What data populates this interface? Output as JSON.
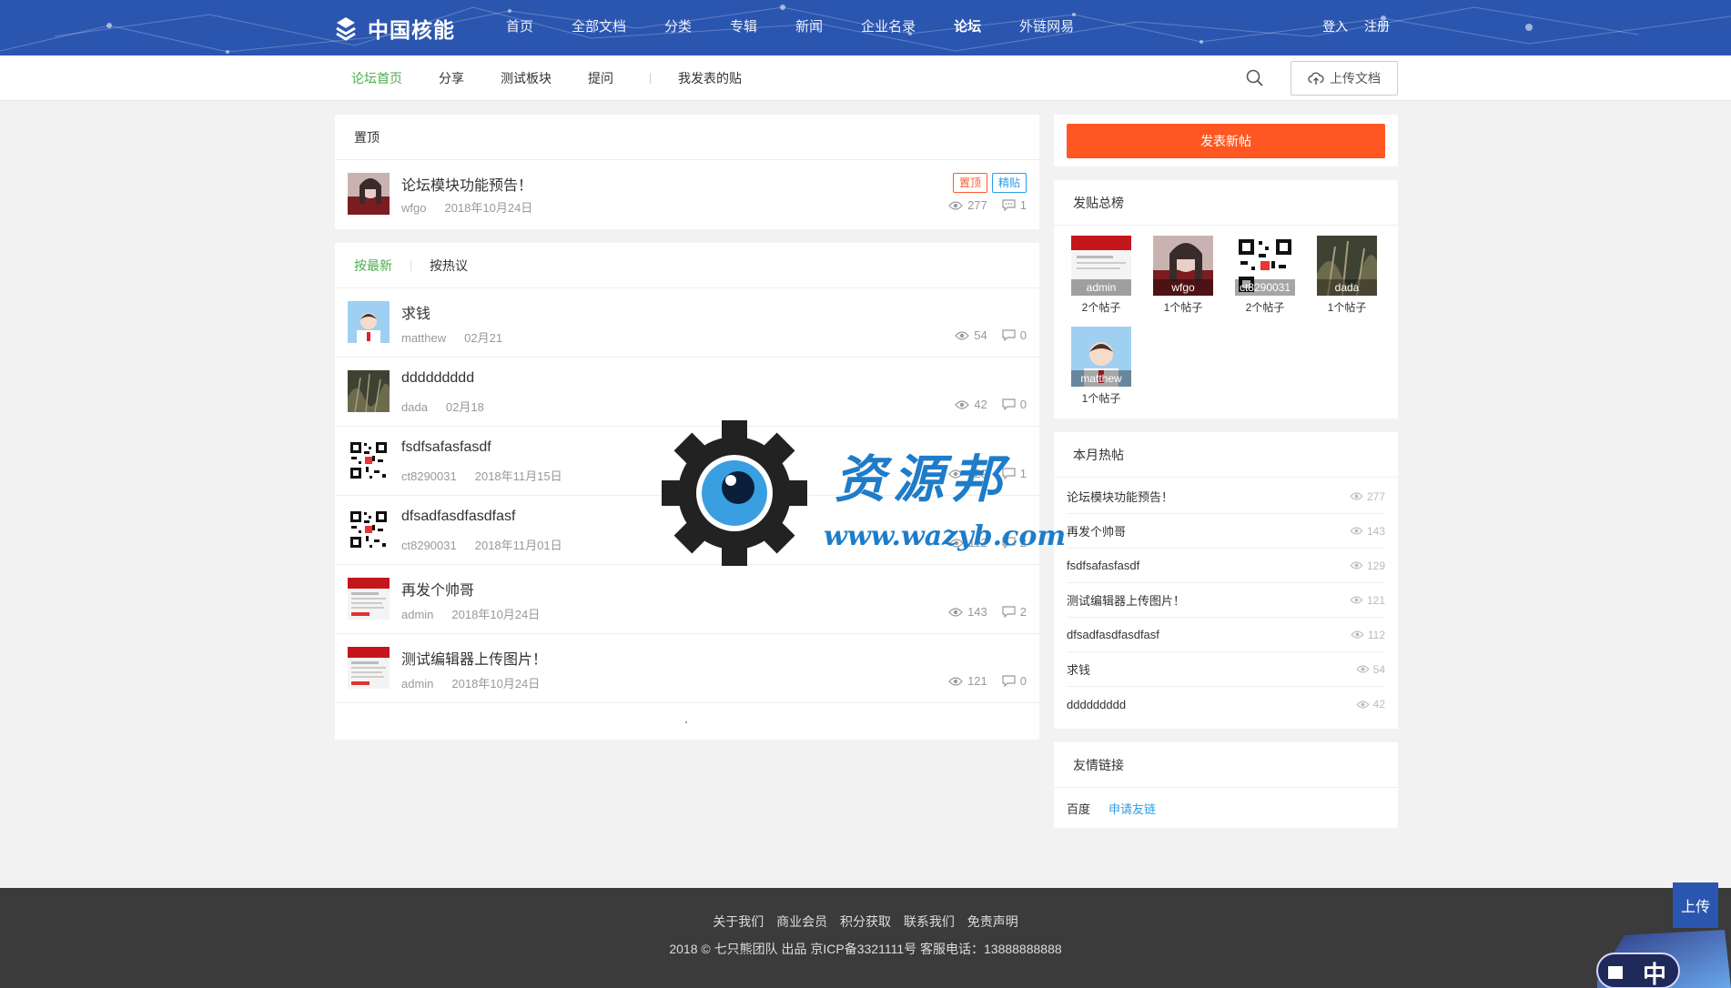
{
  "header": {
    "brand": "中国核能",
    "nav": [
      "首页",
      "全部文档",
      "分类",
      "专辑",
      "新闻",
      "企业名录",
      "论坛",
      "外链网易"
    ],
    "active_nav": "论坛",
    "login": "登入",
    "register": "注册"
  },
  "subnav": {
    "items": [
      "论坛首页",
      "分享",
      "测试板块",
      "提问"
    ],
    "my_posts": "我发表的贴",
    "upload_label": "上传文档"
  },
  "pinned": {
    "title": "置顶",
    "post": {
      "title": "论坛模块功能预告！",
      "author": "wfgo",
      "date": "2018年10月24日",
      "views": "277",
      "comments": "1",
      "tag_top": "置顶",
      "tag_best": "精贴"
    }
  },
  "list": {
    "sort_latest": "按最新",
    "sort_hot": "按热议",
    "posts": [
      {
        "title": "求钱",
        "author": "matthew",
        "date": "02月21",
        "views": "54",
        "comments": "0"
      },
      {
        "title": "ddddddddd",
        "author": "dada",
        "date": "02月18",
        "views": "42",
        "comments": "0"
      },
      {
        "title": "fsdfsafasfasdf",
        "author": "ct8290031",
        "date": "2018年11月15日",
        "views": "129",
        "comments": "1"
      },
      {
        "title": "dfsadfasdfasdfasf",
        "author": "ct8290031",
        "date": "2018年11月01日",
        "views": "112",
        "comments": "2"
      },
      {
        "title": "再发个帅哥",
        "author": "admin",
        "date": "2018年10月24日",
        "views": "143",
        "comments": "2"
      },
      {
        "title": "测试编辑器上传图片！",
        "author": "admin",
        "date": "2018年10月24日",
        "views": "121",
        "comments": "0"
      }
    ]
  },
  "sidebar": {
    "new_post": "发表新帖",
    "rank_title": "发贴总榜",
    "rank": [
      {
        "name": "admin",
        "count": "2个帖子"
      },
      {
        "name": "wfgo",
        "count": "1个帖子"
      },
      {
        "name": "ct8290031",
        "count": "2个帖子"
      },
      {
        "name": "dada",
        "count": "1个帖子"
      },
      {
        "name": "matthew",
        "count": "1个帖子"
      }
    ],
    "hot_title": "本月热帖",
    "hot": [
      {
        "title": "论坛模块功能预告！",
        "views": "277"
      },
      {
        "title": "再发个帅哥",
        "views": "143"
      },
      {
        "title": "fsdfsafasfasdf",
        "views": "129"
      },
      {
        "title": "测试编辑器上传图片！",
        "views": "121"
      },
      {
        "title": "dfsadfasdfasdfasf",
        "views": "112"
      },
      {
        "title": "求钱",
        "views": "54"
      },
      {
        "title": "ddddddddd",
        "views": "42"
      }
    ],
    "links_title": "友情链接",
    "link_baidu": "百度",
    "link_apply": "申请友链"
  },
  "footer": {
    "links": [
      "关于我们",
      "商业会员",
      "积分获取",
      "联系我们",
      "免责声明"
    ],
    "copyright": "2018 © 七只熊团队 出品 京ICP备3321111号 客服电话：13888888888"
  },
  "float_upload": "上传",
  "ime": "中",
  "watermark": {
    "title": "资源邦",
    "url": "www.wazyb.com"
  },
  "colors": {
    "header_bg": "#2b56b0",
    "accent_green": "#4cae4c",
    "button_orange": "#ff5722",
    "link_blue": "#2b9ee6"
  }
}
